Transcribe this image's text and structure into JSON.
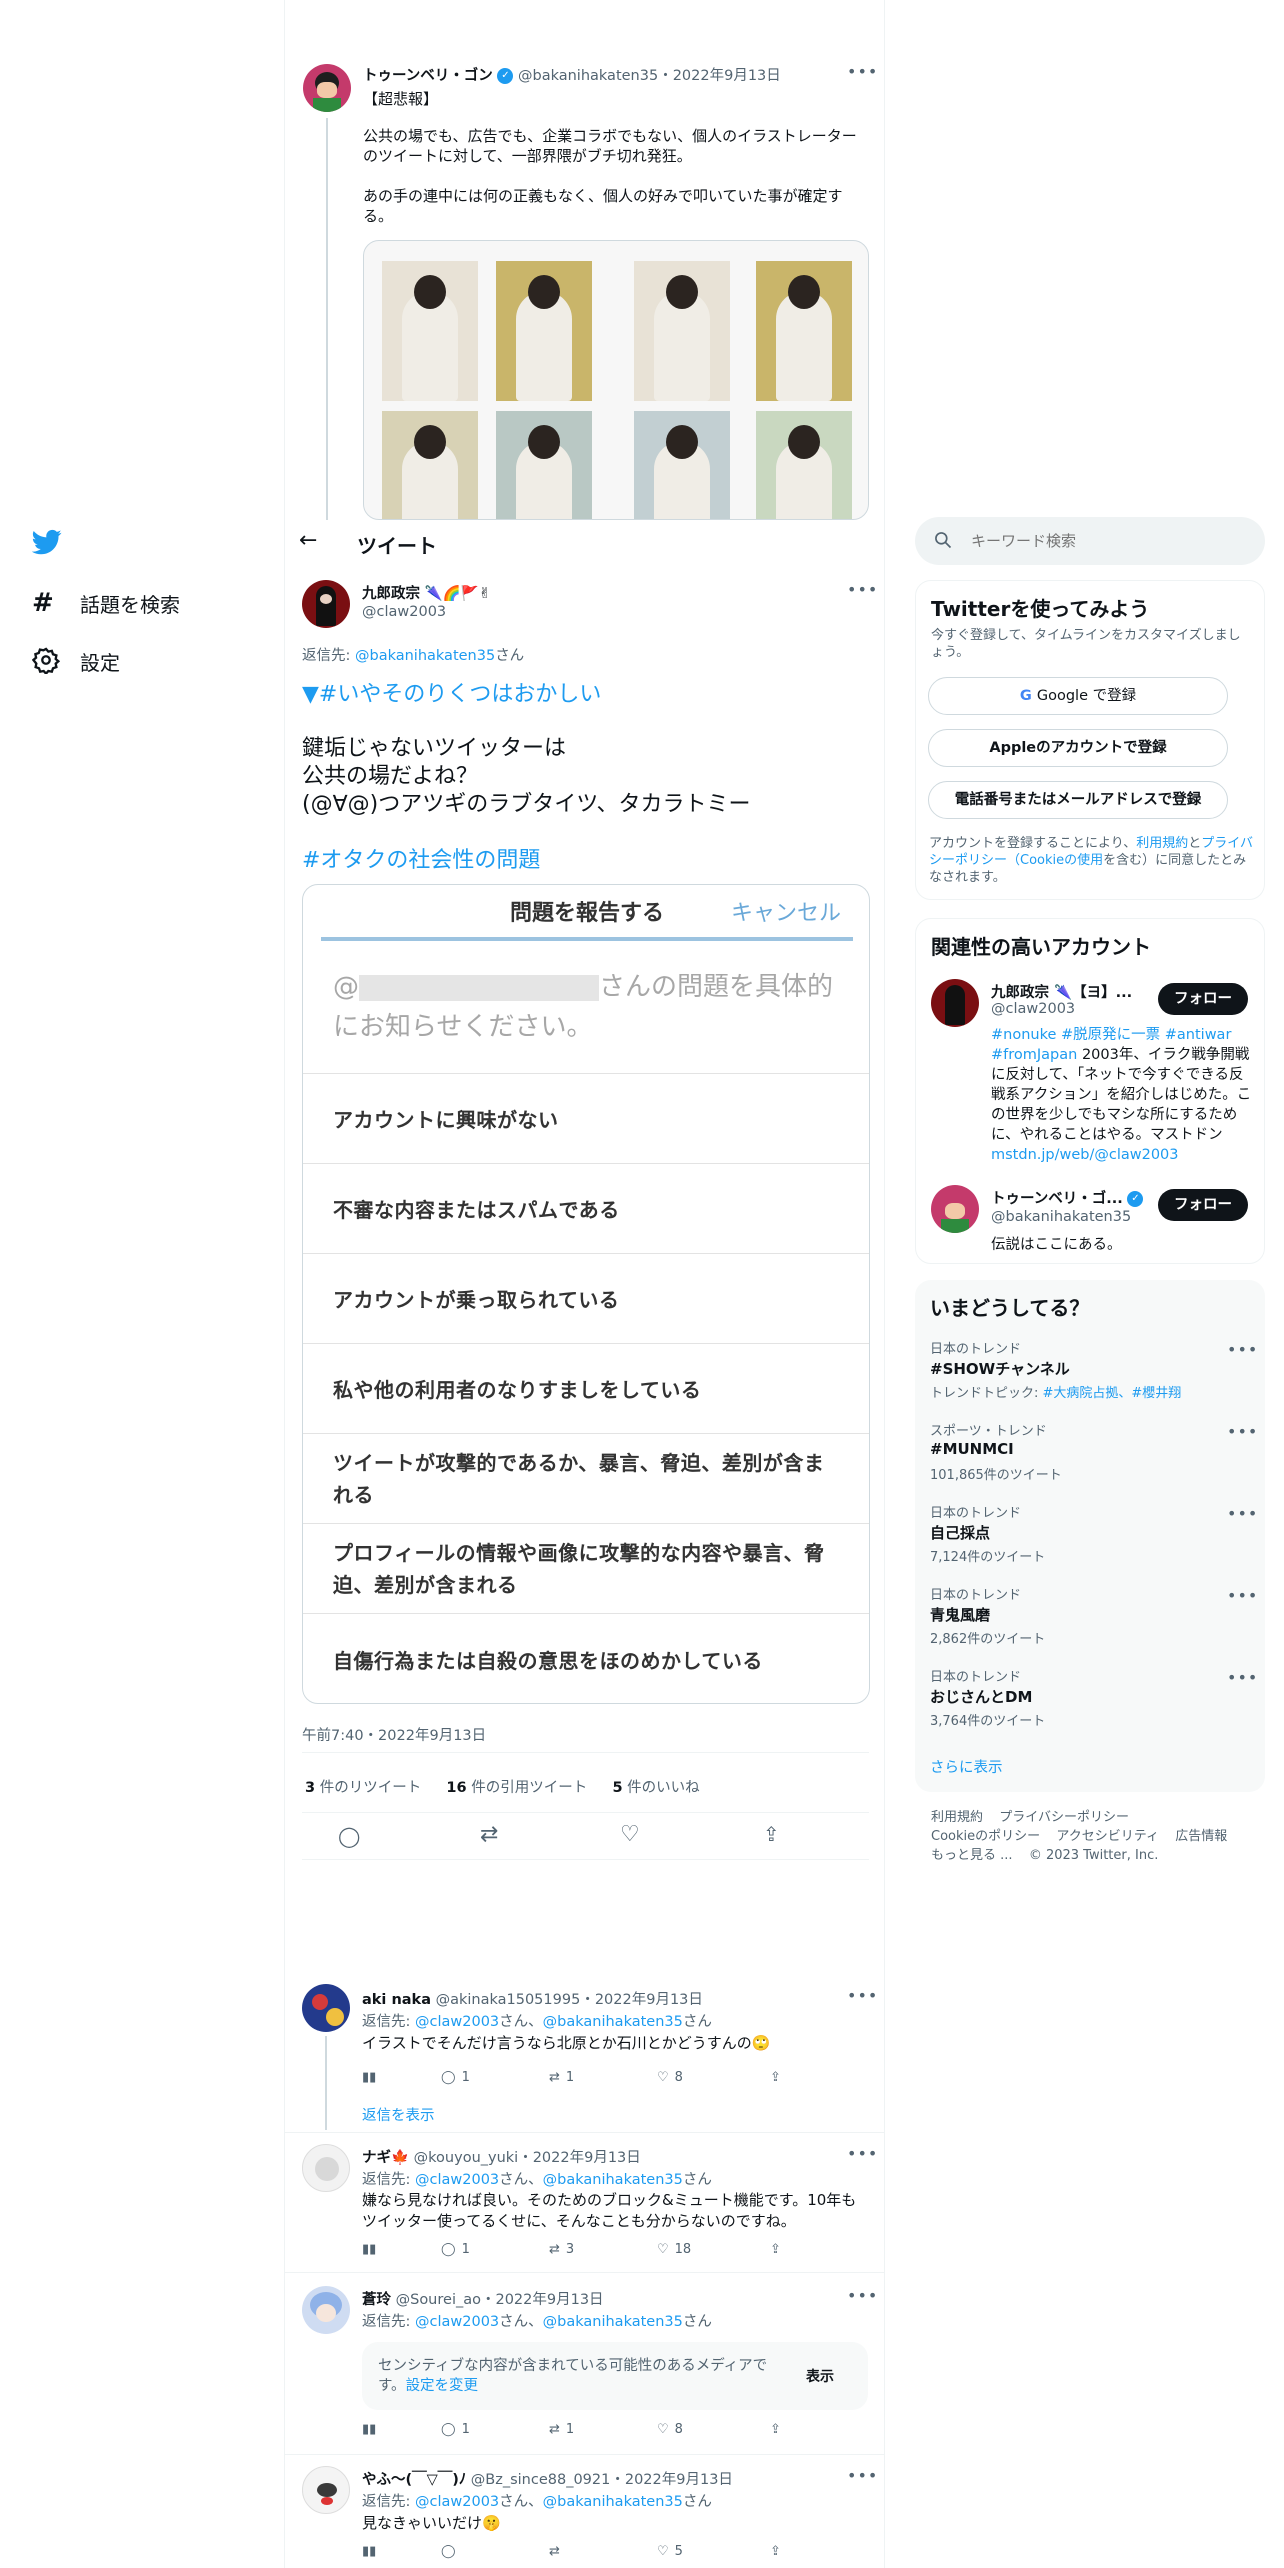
{
  "nav": {
    "explore_label": "話題を検索",
    "settings_label": "設定"
  },
  "header": {
    "title": "ツイート"
  },
  "search": {
    "placeholder": "キーワード検索"
  },
  "quoted_tweet": {
    "name": "トゥーンベリ・ゴン",
    "handle": "@bakanihakaten35",
    "date": "2022年9月13日",
    "line1": "【超悲報】",
    "line2": "公共の場でも、広告でも、企業コラボでもない、個人のイラストレーターのツイートに対して、一部界隈がブチ切れ発狂。",
    "line3": "あの手の連中には何の正義もなく、個人の好みで叩いていた事が確定する。"
  },
  "main_tweet": {
    "name": "九郎政宗",
    "name_emoji": "🌂🌈🚩✌",
    "handle": "@claw2003",
    "reply_prefix": "返信先: ",
    "reply_to": "@bakanihakaten35",
    "reply_suffix": "さん",
    "hashtag1": "▼#いやそのりくつはおかしい",
    "body1": "鍵垢じゃないツイッターは",
    "body2": "公共の場だよね？",
    "body3": "(@∀@)つアツギのラブタイツ、タカラトミー",
    "hashtag2": "#オタクの社会性の問題",
    "timestamp": "午前7:40・2022年9月13日",
    "retweets": "3",
    "retweets_label": "件のリツイート",
    "quotes": "16",
    "quotes_label": "件の引用ツイート",
    "likes": "5",
    "likes_label": "件のいいね"
  },
  "report_dialog": {
    "title": "問題を報告する",
    "cancel": "キャンセル",
    "prompt_at": "@",
    "prompt_text": "さんの問題を具体的にお知らせください。",
    "options": [
      "アカウントに興味がない",
      "不審な内容またはスパムである",
      "アカウントが乗っ取られている",
      "私や他の利用者のなりすましをしている",
      "ツイートが攻撃的であるか、暴言、脅迫、差別が含まれる",
      "プロフィールの情報や画像に攻撃的な内容や暴言、脅迫、差別が含まれる",
      "自傷行為または自殺の意思をほのめかしている"
    ]
  },
  "replies": [
    {
      "name": "aki naka",
      "handle": "@akinaka15051995",
      "date": "2022年9月13日",
      "reply_prefix": "返信先: ",
      "reply_to": "@claw2003",
      "reply_mid": "さん、",
      "reply_to2": "@bakanihakaten35",
      "reply_suffix": "さん",
      "text": "イラストでそんだけ言うなら北原とか石川とかどうすんの🙄",
      "replies": "1",
      "retweets": "1",
      "likes": "8",
      "show_replies": "返信を表示"
    },
    {
      "name": "ナギ🍁",
      "handle": "@kouyou_yuki",
      "date": "2022年9月13日",
      "reply_prefix": "返信先: ",
      "reply_to": "@claw2003",
      "reply_mid": "さん、",
      "reply_to2": "@bakanihakaten35",
      "reply_suffix": "さん",
      "text": "嫌なら見なければ良い。そのためのブロック&ミュート機能です。10年もツイッター使ってるくせに、そんなことも分からないのですね。",
      "replies": "1",
      "retweets": "3",
      "likes": "18"
    },
    {
      "name": "蒼玲",
      "handle": "@Sourei_ao",
      "date": "2022年9月13日",
      "reply_prefix": "返信先: ",
      "reply_to": "@claw2003",
      "reply_mid": "さん、",
      "reply_to2": "@bakanihakaten35",
      "reply_suffix": "さん",
      "sensitive_text": "センシティブな内容が含まれている可能性のあるメディアです。",
      "sensitive_link": "設定を変更",
      "sensitive_button": "表示",
      "replies": "1",
      "retweets": "1",
      "likes": "8"
    },
    {
      "name": "やふ〜(￣▽￣)ﾉ",
      "handle": "@Bz_since88_0921",
      "date": "2022年9月13日",
      "reply_prefix": "返信先: ",
      "reply_to": "@claw2003",
      "reply_mid": "さん、",
      "reply_to2": "@bakanihakaten35",
      "reply_suffix": "さん",
      "text": "見なきゃいいだけ🤫",
      "likes": "5"
    }
  ],
  "signup": {
    "title": "Twitterを使ってみよう",
    "subtitle": "今すぐ登録して、タイムラインをカスタマイズしましょう。",
    "google": "Google で登録",
    "apple": "Appleのアカウントで登録",
    "phone": "電話番号またはメールアドレスで登録",
    "terms_1": "アカウントを登録することにより、",
    "terms_link1": "利用規約",
    "terms_2": "と",
    "terms_link2": "プライバシーポリシー（Cookieの使用",
    "terms_3": "を含む）に同意したとみなされます。"
  },
  "related": {
    "title": "関連性の高いアカウント",
    "accounts": [
      {
        "name": "九郎政宗 🌂【ヨ】...",
        "handle": "@claw2003",
        "follow": "フォロー",
        "bio_tags": "#nonuke #脱原発に一票 #antiwar #fromJapan",
        "bio": " 2003年、イラク戦争開戦に反対して、「ネットで今すぐできる反戦系アクション」を紹介しはじめた。この世界を少しでもマシな所にするために、やれることはやる。マストドン",
        "bio_link": "mstdn.jp/web/@claw2003"
      },
      {
        "name": "トゥーンベリ・ゴ...",
        "handle": "@bakanihakaten35",
        "follow": "フォロー",
        "bio": "伝説はここにある。"
      }
    ]
  },
  "trends": {
    "title": "いまどうしてる？",
    "items": [
      {
        "meta": "日本のトレンド",
        "name": "#SHOWチャンネル",
        "extra_prefix": "トレンドトピック: ",
        "extra_links": "#大病院占拠、#櫻井翔"
      },
      {
        "meta": "スポーツ・トレンド",
        "name": "#MUNMCI",
        "count": "101,865件のツイート"
      },
      {
        "meta": "日本のトレンド",
        "name": "自己採点",
        "count": "7,124件のツイート"
      },
      {
        "meta": "日本のトレンド",
        "name": "青鬼風磨",
        "count": "2,862件のツイート"
      },
      {
        "meta": "日本のトレンド",
        "name": "おじさんとDM",
        "count": "3,764件のツイート"
      }
    ],
    "show_more": "さらに表示"
  },
  "footer": {
    "terms": "利用規約",
    "privacy": "プライバシーポリシー",
    "cookie": "Cookieのポリシー",
    "accessibility": "アクセシビリティ",
    "ads": "広告情報",
    "more": "もっと見る ...",
    "copyright": "© 2023 Twitter, Inc."
  },
  "colors": {
    "accent": "#1d9bf0",
    "text": "#0f1419",
    "muted": "#536471"
  }
}
